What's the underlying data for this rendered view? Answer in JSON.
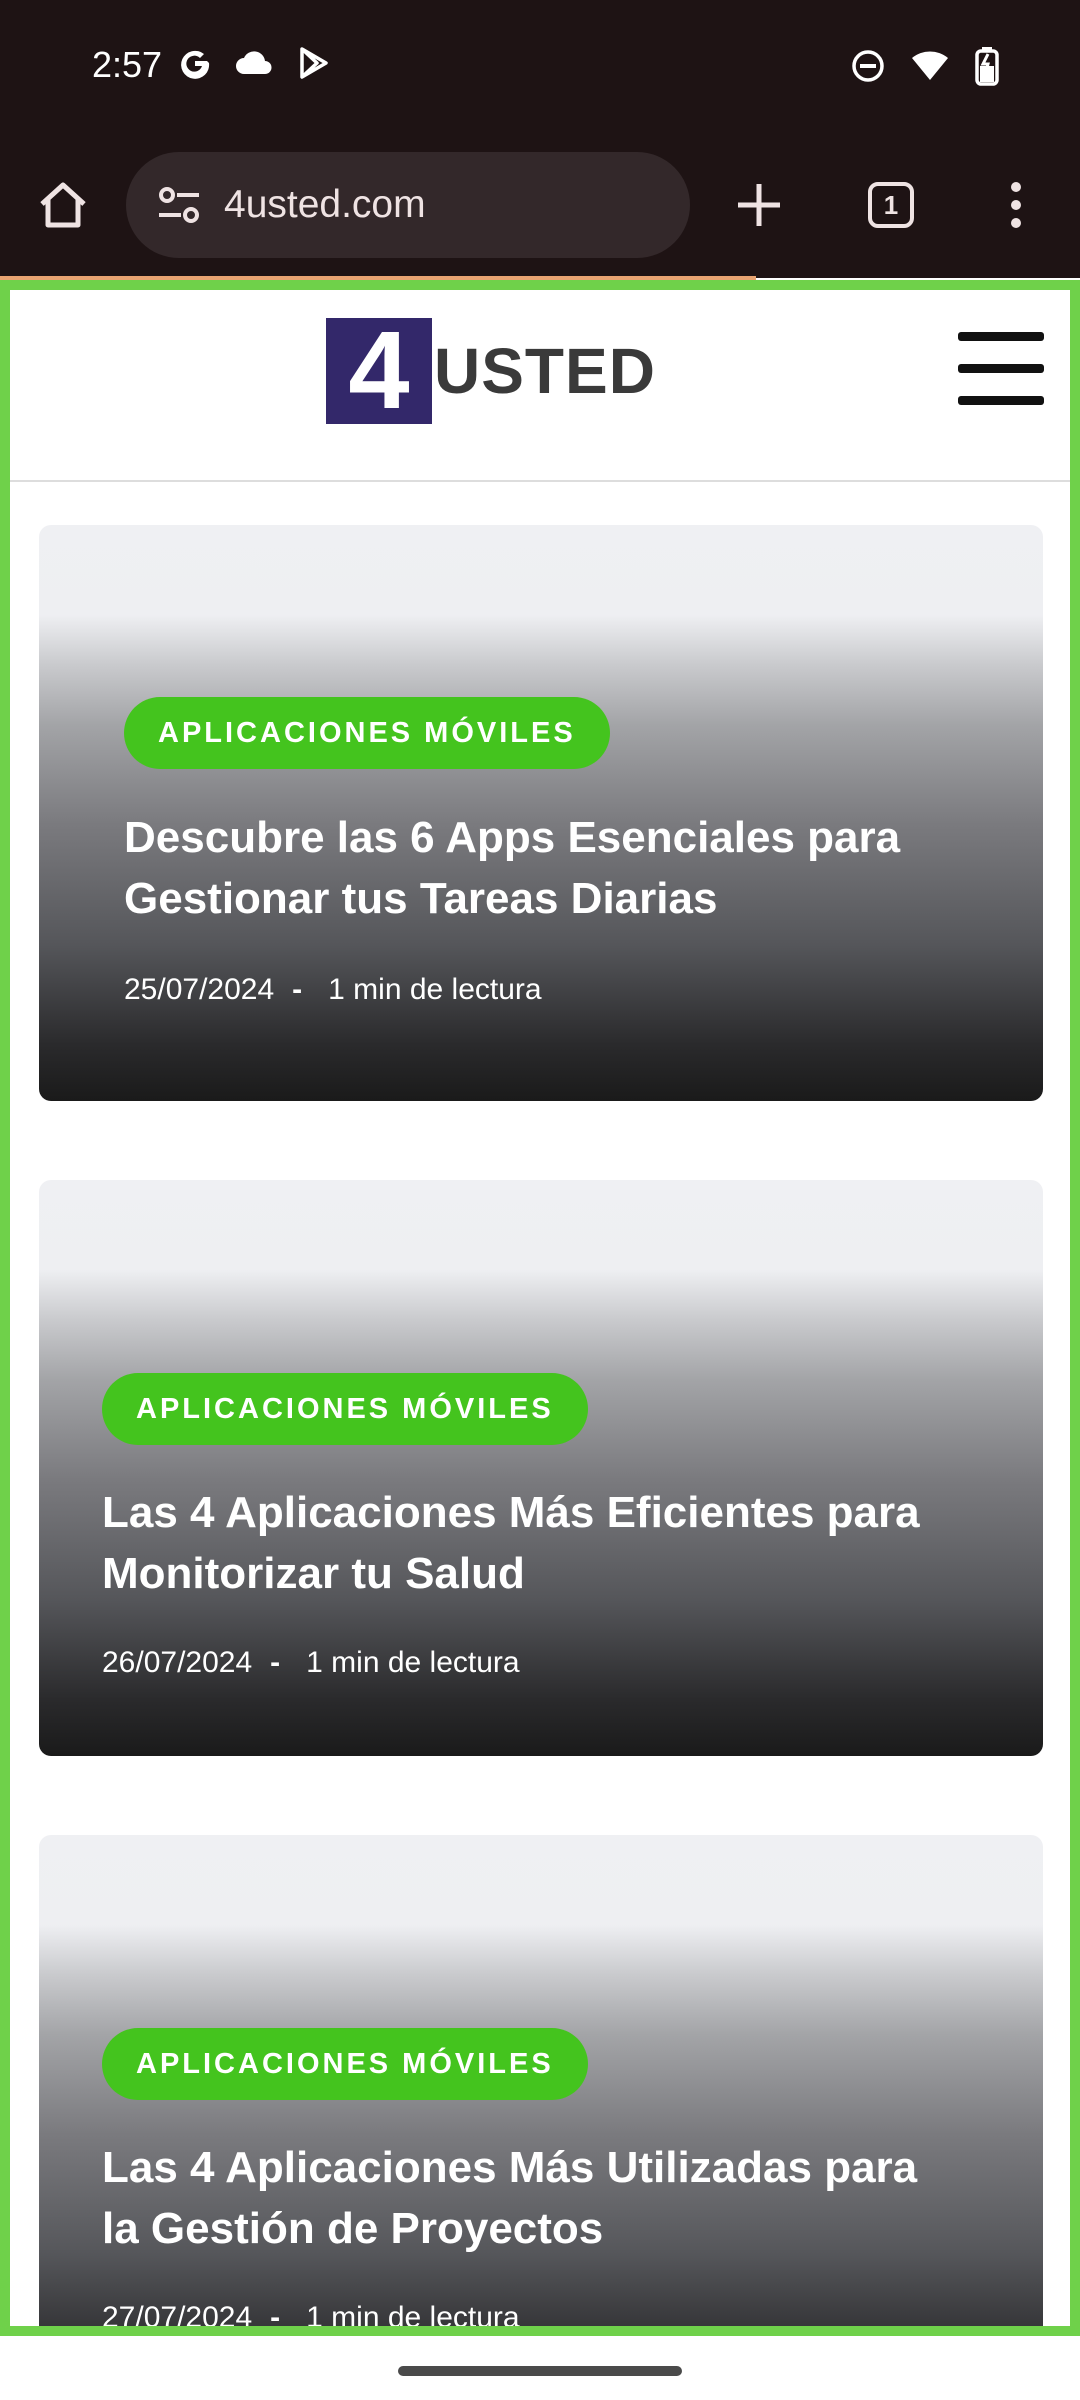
{
  "status_bar": {
    "time": "2:57",
    "left_icons": [
      "google-icon",
      "cloud-icon",
      "play-store-icon"
    ],
    "right_icons": [
      "dnd-icon",
      "wifi-icon",
      "battery-icon"
    ]
  },
  "browser": {
    "url": "4usted.com",
    "tab_count": "1"
  },
  "site": {
    "logo_mark": "4",
    "logo_text": "USTED",
    "logo_color": "#33286a"
  },
  "articles": [
    {
      "category": "APLICACIONES MÓVILES",
      "title": "Descubre las 6 Apps Esenciales para Gestionar tus Tareas Diarias",
      "date": "25/07/2024",
      "separator": "-",
      "read_time": "1 min de lectura"
    },
    {
      "category": "APLICACIONES MÓVILES",
      "title": "Las 4 Aplicaciones Más Eficientes para Monitorizar tu Salud",
      "date": "26/07/2024",
      "separator": "-",
      "read_time": "1 min de lectura"
    },
    {
      "category": "APLICACIONES MÓVILES",
      "title": "Las 4 Aplicaciones Más Utilizadas para la Gestión de Proyectos",
      "date": "27/07/2024",
      "separator": "-",
      "read_time": "1 min de lectura"
    }
  ],
  "colors": {
    "badge": "#44c41e",
    "browser_chrome": "#1e1314",
    "frame_highlight": "#6fd14a"
  }
}
